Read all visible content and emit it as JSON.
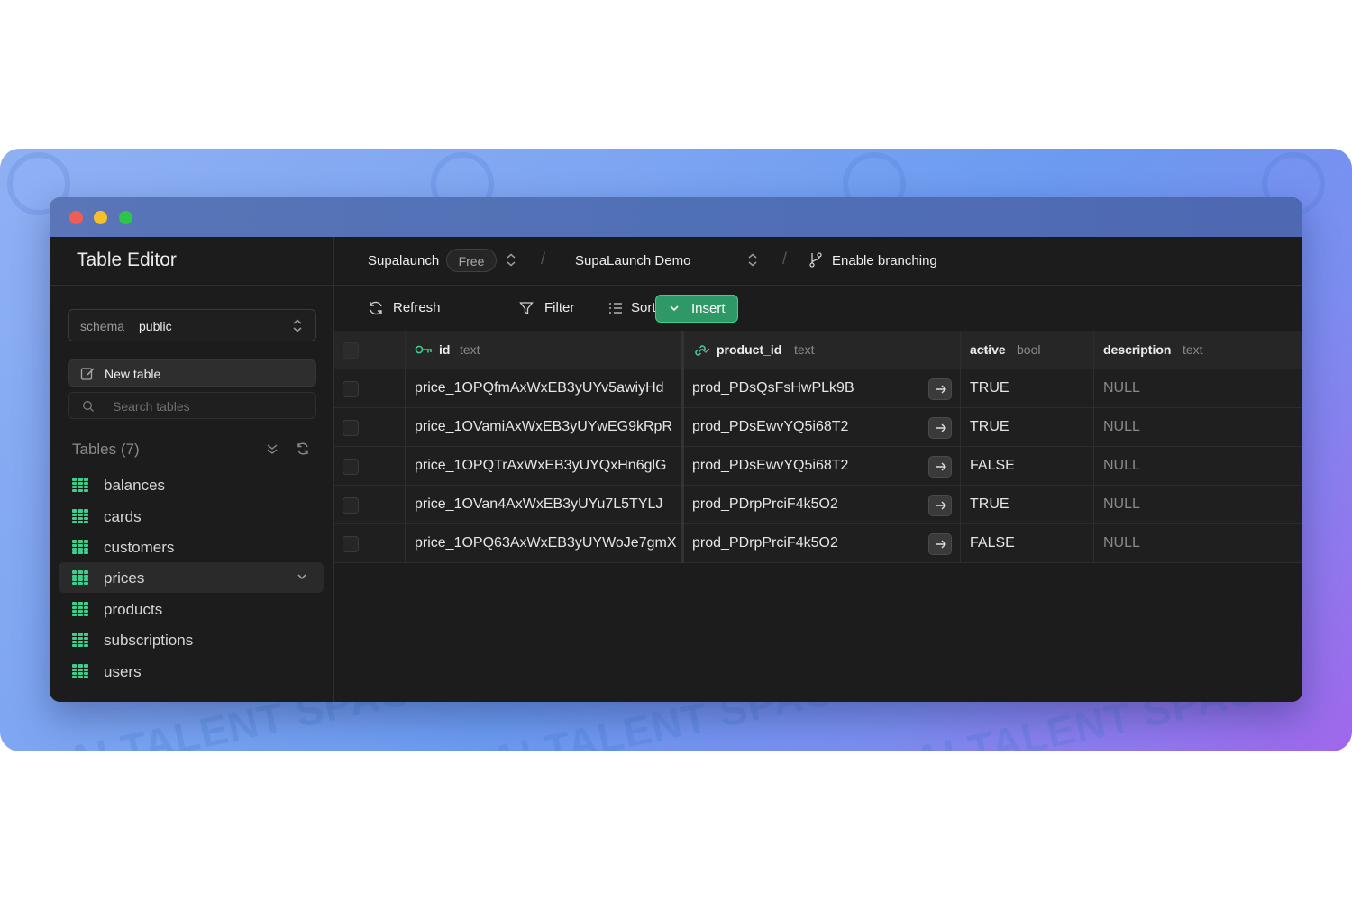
{
  "colors": {
    "accent": "#3ecf8e",
    "insert_bg": "#2e9966",
    "window_bg": "#1c1c1c",
    "titlebar": "#5070b6",
    "traffic_red": "#ee5e57",
    "traffic_yellow": "#f5c02d",
    "traffic_green": "#2ec648"
  },
  "watermark": "AI TALENT SPACE",
  "sidebar": {
    "title": "Table Editor",
    "schema_label": "schema",
    "schema_value": "public",
    "new_table_label": "New table",
    "search_placeholder": "Search tables",
    "tables_heading": "Tables (7)",
    "tables": [
      {
        "name": "balances"
      },
      {
        "name": "cards"
      },
      {
        "name": "customers"
      },
      {
        "name": "prices",
        "active": true
      },
      {
        "name": "products"
      },
      {
        "name": "subscriptions"
      },
      {
        "name": "users"
      }
    ]
  },
  "topbar": {
    "org": "Supalaunch",
    "plan_badge": "Free",
    "project": "SupaLaunch Demo",
    "branching": "Enable branching"
  },
  "toolbar": {
    "refresh": "Refresh",
    "filter": "Filter",
    "sort": "Sort",
    "insert": "Insert"
  },
  "grid": {
    "columns": [
      {
        "name": "id",
        "type": "text",
        "icon": "key-icon"
      },
      {
        "name": "product_id",
        "type": "text",
        "icon": "link-icon"
      },
      {
        "name": "active",
        "type": "bool"
      },
      {
        "name": "description",
        "type": "text"
      }
    ],
    "rows": [
      {
        "id": "price_1OPQfmAxWxEB3yUYv5awiyHd",
        "product_id": "prod_PDsQsFsHwPLk9B",
        "active": "TRUE",
        "description": "NULL"
      },
      {
        "id": "price_1OVamiAxWxEB3yUYwEG9kRpR",
        "product_id": "prod_PDsEwvYQ5i68T2",
        "active": "TRUE",
        "description": "NULL"
      },
      {
        "id": "price_1OPQTrAxWxEB3yUYQxHn6glG",
        "product_id": "prod_PDsEwvYQ5i68T2",
        "active": "FALSE",
        "description": "NULL"
      },
      {
        "id": "price_1OVan4AxWxEB3yUYu7L5TYLJ",
        "product_id": "prod_PDrpPrciF4k5O2",
        "active": "TRUE",
        "description": "NULL"
      },
      {
        "id": "price_1OPQ63AxWxEB3yUYWoJe7gmX",
        "product_id": "prod_PDrpPrciF4k5O2",
        "active": "FALSE",
        "description": "NULL"
      }
    ]
  }
}
